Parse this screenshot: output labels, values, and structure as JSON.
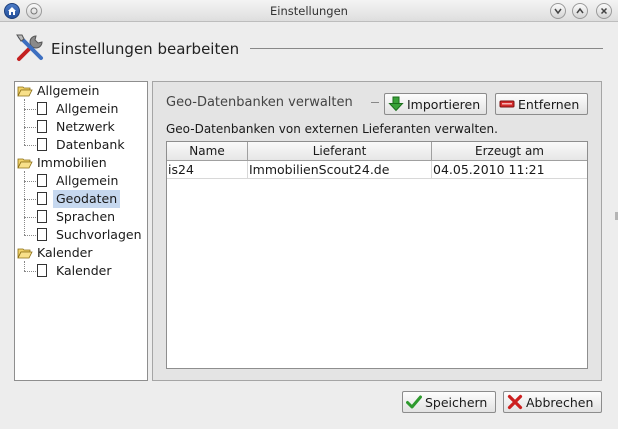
{
  "window": {
    "title": "Einstellungen"
  },
  "header": {
    "title": "Einstellungen bearbeiten",
    "icon": "tools-icon"
  },
  "tree": {
    "groups": [
      {
        "label": "Allgemein",
        "items": [
          "Allgemein",
          "Netzwerk",
          "Datenbank"
        ]
      },
      {
        "label": "Immobilien",
        "items": [
          "Allgemein",
          "Geodaten",
          "Sprachen",
          "Suchvorlagen"
        ]
      },
      {
        "label": "Kalender",
        "items": [
          "Kalender"
        ]
      }
    ],
    "selected": "Geodaten"
  },
  "section": {
    "title": "Geo-Datenbanken verwalten",
    "description": "Geo-Datenbanken von externen Lieferanten verwalten.",
    "import_label": "Importieren",
    "remove_label": "Entfernen"
  },
  "table": {
    "columns": [
      "Name",
      "Lieferant",
      "Erzeugt am"
    ],
    "rows": [
      [
        "is24",
        "ImmobilienScout24.de",
        "04.05.2010 11:21"
      ]
    ]
  },
  "footer": {
    "save_label": "Speichern",
    "cancel_label": "Abbrechen"
  },
  "colors": {
    "accent_blue": "#2b5aa8",
    "selection": "#c6d8ef",
    "ok_green": "#2e9a2e",
    "cancel_red": "#cc1f1f"
  }
}
